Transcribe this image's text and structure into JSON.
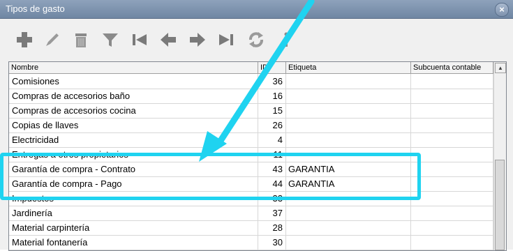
{
  "window": {
    "title": "Tipos de gasto",
    "close_glyph": "×"
  },
  "toolbar": {
    "buttons": [
      {
        "name": "add-icon"
      },
      {
        "name": "edit-icon"
      },
      {
        "name": "delete-icon"
      },
      {
        "name": "filter-icon"
      },
      {
        "name": "first-record-icon"
      },
      {
        "name": "previous-record-icon"
      },
      {
        "name": "next-record-icon"
      },
      {
        "name": "last-record-icon"
      },
      {
        "name": "refresh-icon"
      },
      {
        "name": "info-icon"
      }
    ]
  },
  "grid": {
    "columns": [
      "Nombre",
      "ID",
      "Etiqueta",
      "Subcuenta contable"
    ],
    "rows": [
      {
        "nombre": "Comisiones",
        "id": "36",
        "etiqueta": "",
        "subcuenta": ""
      },
      {
        "nombre": "Compras de accesorios baño",
        "id": "16",
        "etiqueta": "",
        "subcuenta": ""
      },
      {
        "nombre": "Compras de accesorios cocina",
        "id": "15",
        "etiqueta": "",
        "subcuenta": ""
      },
      {
        "nombre": "Copias de llaves",
        "id": "26",
        "etiqueta": "",
        "subcuenta": ""
      },
      {
        "nombre": "Electricidad",
        "id": "4",
        "etiqueta": "",
        "subcuenta": ""
      },
      {
        "nombre": "Entregas a otros propietarios",
        "id": "11",
        "etiqueta": "",
        "subcuenta": ""
      },
      {
        "nombre": "Garantía de compra - Contrato",
        "id": "43",
        "etiqueta": "GARANTIA",
        "subcuenta": ""
      },
      {
        "nombre": "Garantía de compra - Pago",
        "id": "44",
        "etiqueta": "GARANTIA",
        "subcuenta": ""
      },
      {
        "nombre": "Impuestos",
        "id": "33",
        "etiqueta": "",
        "subcuenta": ""
      },
      {
        "nombre": "Jardinería",
        "id": "37",
        "etiqueta": "",
        "subcuenta": ""
      },
      {
        "nombre": "Material carpintería",
        "id": "28",
        "etiqueta": "",
        "subcuenta": ""
      },
      {
        "nombre": "Material fontanería",
        "id": "30",
        "etiqueta": "",
        "subcuenta": ""
      }
    ]
  },
  "annotation": {
    "color": "#1fd3f0"
  }
}
